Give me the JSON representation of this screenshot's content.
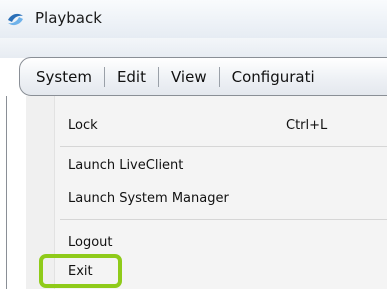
{
  "window": {
    "title": "Playback",
    "icon": "playback-app-icon"
  },
  "menubar": {
    "items": [
      {
        "label": "System"
      },
      {
        "label": "Edit"
      },
      {
        "label": "View"
      },
      {
        "label": "Configurati"
      }
    ]
  },
  "system_menu": {
    "items": [
      {
        "label": "Lock",
        "shortcut": "Ctrl+L"
      },
      {
        "label": "Launch LiveClient"
      },
      {
        "label": "Launch System Manager"
      },
      {
        "label": "Logout"
      },
      {
        "label": "Exit"
      }
    ]
  },
  "colors": {
    "highlight": "#8fcb1a"
  }
}
